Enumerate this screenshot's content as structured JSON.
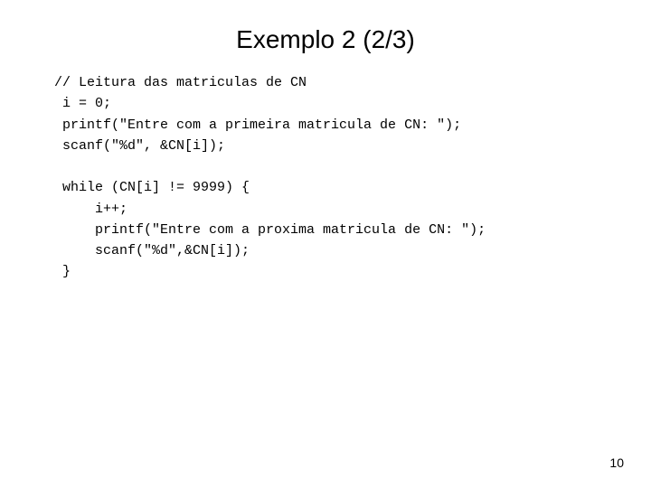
{
  "title": "Exemplo 2 (2/3)",
  "code": "// Leitura das matriculas de CN\n i = 0;\n printf(\"Entre com a primeira matricula de CN: \");\n scanf(\"%d\", &CN[i]);\n\n while (CN[i] != 9999) {\n     i++;\n     printf(\"Entre com a proxima matricula de CN: \");\n     scanf(\"%d\",&CN[i]);\n }",
  "page_number": "10"
}
